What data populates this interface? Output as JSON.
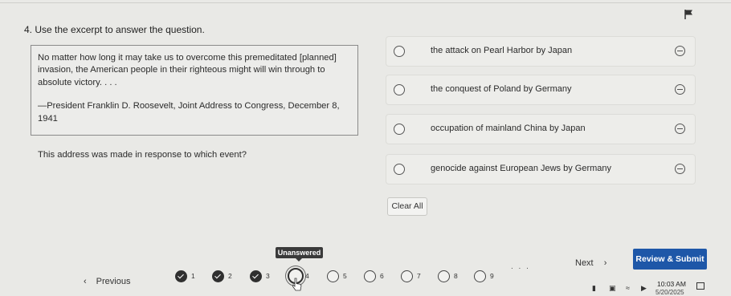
{
  "question": {
    "title": "4. Use the excerpt to answer the question.",
    "excerpt_text": "No matter how long it may take us to overcome this premeditated [planned] invasion, the American people in their righteous might will win through to absolute victory. . . .",
    "excerpt_attribution": "—President Franklin D. Roosevelt, Joint Address to Congress, December 8, 1941",
    "prompt": "This address was made in response to which event?"
  },
  "choices": [
    {
      "label": "the attack on Pearl Harbor by Japan"
    },
    {
      "label": "the conquest of Poland by Germany"
    },
    {
      "label": "occupation of mainland China by Japan"
    },
    {
      "label": "genocide against European Jews by Germany"
    }
  ],
  "clear_all_label": "Clear All",
  "navigation": {
    "previous_label": "Previous",
    "next_label": "Next",
    "review_label": "Review & Submit",
    "tooltip": "Unanswered",
    "ellipsis": ". . .",
    "questions": [
      {
        "num": "1",
        "state": "answered"
      },
      {
        "num": "2",
        "state": "answered"
      },
      {
        "num": "3",
        "state": "answered"
      },
      {
        "num": "4",
        "state": "current"
      },
      {
        "num": "5",
        "state": "unanswered"
      },
      {
        "num": "6",
        "state": "unanswered"
      },
      {
        "num": "7",
        "state": "unanswered"
      },
      {
        "num": "8",
        "state": "unanswered"
      },
      {
        "num": "9",
        "state": "unanswered"
      }
    ]
  },
  "taskbar": {
    "time": "10:03 AM",
    "date": "5/20/2025"
  },
  "icons": {
    "flag": "flag-icon",
    "radio": "radio-button",
    "eliminate": "eliminate-choice-icon",
    "prev_chevron": "chevron-left-icon",
    "next_chevron": "chevron-right-icon"
  },
  "colors": {
    "review_button": "#1e57a8",
    "answered": "#2f2f2f"
  }
}
